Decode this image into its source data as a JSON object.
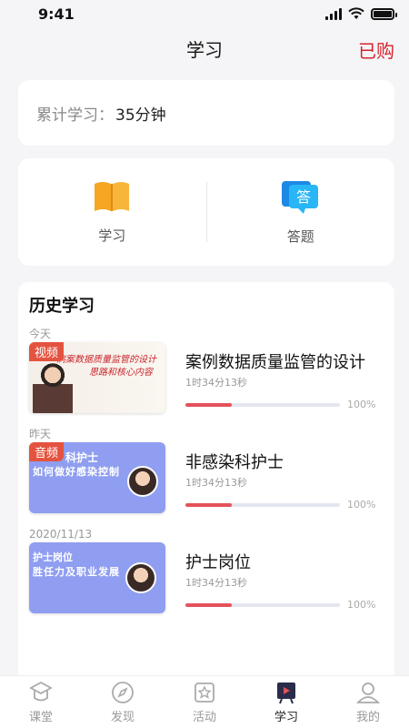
{
  "status_bar": {
    "time": "9:41"
  },
  "nav": {
    "title": "学习",
    "action": "已购"
  },
  "total": {
    "label": "累计学习：",
    "value": "35分钟"
  },
  "entries": [
    {
      "label": "学习",
      "icon": "book-icon"
    },
    {
      "label": "答题",
      "icon": "answer-icon",
      "badge": "答"
    }
  ],
  "history": {
    "title": "历史学习",
    "groups": [
      {
        "date": "今天",
        "item": {
          "title": "案例数据质量监管的设计",
          "duration": "1时34分13秒",
          "progress": 0.3,
          "progress_text": "100%",
          "thumb_tag": "视频",
          "thumb_line1": "病案数据质量监管的设计",
          "thumb_line2": "思路和核心内容"
        }
      },
      {
        "date": "昨天",
        "item": {
          "title": "非感染科护士",
          "duration": "1时34分13秒",
          "progress": 0.3,
          "progress_text": "100%",
          "thumb_tag": "音频",
          "thumb_line1": "科护士",
          "thumb_line2": "如何做好感染控制"
        }
      },
      {
        "date": "2020/11/13",
        "item": {
          "title": "护士岗位",
          "duration": "1时34分13秒",
          "progress": 0.3,
          "progress_text": "100%",
          "thumb_tag": "",
          "thumb_line1": "护士岗位",
          "thumb_line2": "胜任力及职业发展"
        }
      }
    ]
  },
  "tabs": [
    {
      "label": "课堂",
      "icon": "classroom-icon"
    },
    {
      "label": "发现",
      "icon": "compass-icon"
    },
    {
      "label": "活动",
      "icon": "star-icon"
    },
    {
      "label": "学习",
      "icon": "study-icon",
      "active": true
    },
    {
      "label": "我的",
      "icon": "profile-icon"
    }
  ],
  "colors": {
    "accent": "#d4232e",
    "progress": "#e4515a",
    "tag": "#e4533f"
  }
}
